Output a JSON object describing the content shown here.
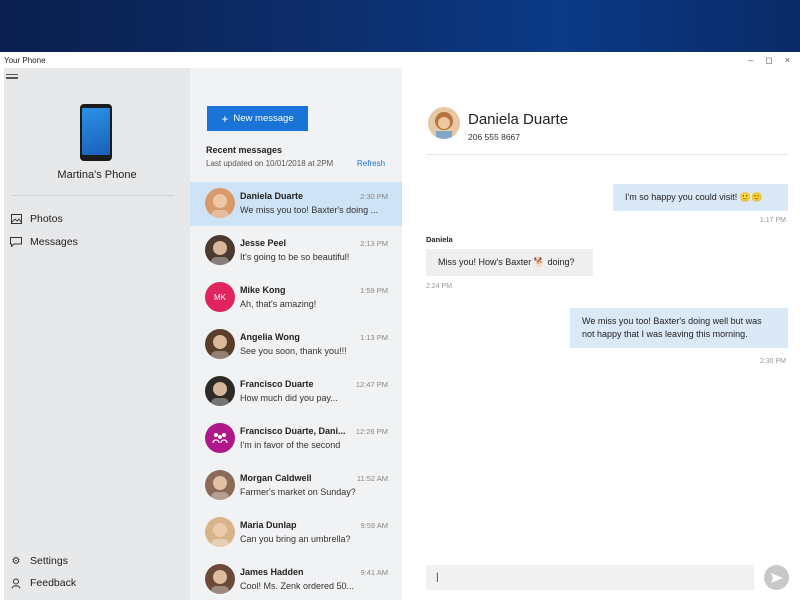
{
  "window": {
    "title": "Your Phone",
    "controls": {
      "minimize": "–",
      "maximize": "◻",
      "close": "×"
    }
  },
  "nav": {
    "phone_name": "Martina's Phone",
    "items": [
      {
        "label": "Photos",
        "icon": "photos-icon"
      },
      {
        "label": "Messages",
        "icon": "messages-icon"
      }
    ],
    "bottom_items": [
      {
        "label": "Settings",
        "icon": "gear-icon"
      },
      {
        "label": "Feedback",
        "icon": "feedback-icon"
      }
    ]
  },
  "list": {
    "new_message_label": "New message",
    "recent_title": "Recent messages",
    "last_updated": "Last updated on 10/01/2018 at 2PM",
    "refresh_label": "Refresh",
    "conversations": [
      {
        "name": "Daniela Duarte",
        "time": "2:30 PM",
        "preview": "We miss you too! Baxter's doing ...",
        "avatar_color": "#d89a6a",
        "initials": "",
        "selected": true
      },
      {
        "name": "Jesse Peel",
        "time": "2:13 PM",
        "preview": "It's going to be so beautiful!",
        "avatar_color": "#4a3a32",
        "initials": ""
      },
      {
        "name": "Mike Kong",
        "time": "1:59 PM",
        "preview": "Ah, that's amazing!",
        "avatar_color": "#e0245e",
        "initials": "MK"
      },
      {
        "name": "Angelia Wong",
        "time": "1:13 PM",
        "preview": "See you soon, thank you!!!",
        "avatar_color": "#5a3d2b",
        "initials": ""
      },
      {
        "name": "Francisco Duarte",
        "time": "12:47 PM",
        "preview": "How much did you pay...",
        "avatar_color": "#2e2a28",
        "initials": ""
      },
      {
        "name": "Francisco Duarte, Dani...",
        "time": "12:26 PM",
        "preview": "I'm in favor of the second",
        "avatar_color": "#b0188a",
        "initials": ""
      },
      {
        "name": "Morgan Caldwell",
        "time": "11:52 AM",
        "preview": "Farmer's market on Sunday?",
        "avatar_color": "#8b6a5a",
        "initials": ""
      },
      {
        "name": "Maria Dunlap",
        "time": "9:59 AM",
        "preview": "Can you bring an umbrella?",
        "avatar_color": "#d8b48a",
        "initials": ""
      },
      {
        "name": "James Hadden",
        "time": "9:41 AM",
        "preview": "Cool! Ms. Zenk ordered 50...",
        "avatar_color": "#6b4a3a",
        "initials": ""
      }
    ]
  },
  "chat": {
    "contact_name": "Daniela Duarte",
    "contact_phone": "206 555 8667",
    "messages": [
      {
        "direction": "sent",
        "text": "I'm so happy you could visit! 🙂🙂",
        "time": "1:17 PM"
      },
      {
        "direction": "received",
        "sender": "Daniela",
        "text": "Miss you! How's Baxter 🐕 doing?",
        "time": "2:24 PM"
      },
      {
        "direction": "sent",
        "text": "We miss you too! Baxter's doing well but was not happy that I was leaving this morning.",
        "time": "2:30 PM"
      }
    ],
    "compose_value": "|",
    "send_icon": "send-icon"
  },
  "colors": {
    "accent": "#1a73d6",
    "nav_bg": "#e7e8ea",
    "list_bg": "#f1f2f4",
    "selected_bg": "#cfe3f6",
    "sent_bubble": "#dbe9f7",
    "received_bubble": "#efefef"
  }
}
